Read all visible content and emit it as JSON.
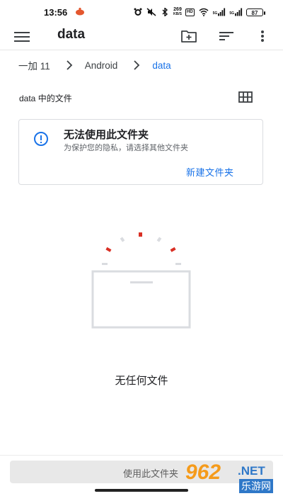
{
  "status_bar": {
    "time": "13:56",
    "network_speed_value": "269",
    "network_speed_unit": "KB/S",
    "hd_badge": "HD",
    "signal_1": "5G",
    "signal_2": "5G",
    "battery": "87"
  },
  "app_bar": {
    "title": "data",
    "icons": [
      "menu-icon",
      "new-folder-icon",
      "sort-icon",
      "more-vert-icon"
    ]
  },
  "breadcrumb": [
    "一加 11",
    "Android",
    "data"
  ],
  "section_title": "data 中的文件",
  "notice_card": {
    "title": "无法使用此文件夹",
    "subtitle": "为保护您的隐私，请选择其他文件夹",
    "action": "新建文件夹"
  },
  "empty_state": {
    "message": "无任何文件"
  },
  "bottom": {
    "use_folder_button": "使用此文件夹"
  },
  "watermark": {
    "number": "962",
    "suffix": ".NET",
    "chinese": "乐游网"
  },
  "colors": {
    "accent": "#1a73e8",
    "spark_red": "#d93025",
    "spark_gray": "#dadce0"
  }
}
